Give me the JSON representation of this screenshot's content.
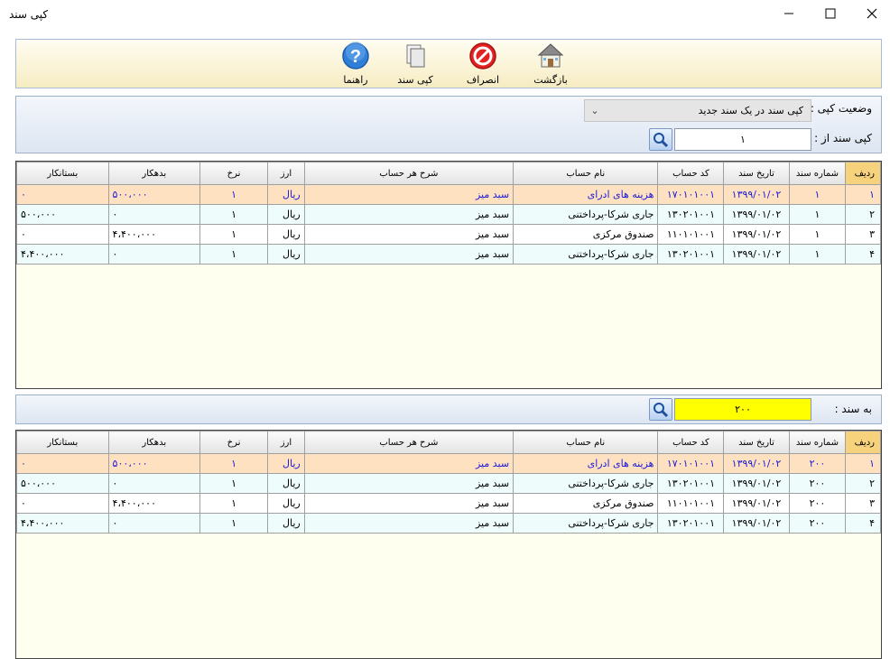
{
  "window": {
    "title": "کپی سند"
  },
  "toolbar": {
    "back_label": "بازگشت",
    "cancel_label": "انصراف",
    "copy_label": "کپی سند",
    "help_label": "راهنما"
  },
  "copy_panel": {
    "status_label": "وضعیت کپی :",
    "status_value": "کپی سند در یک سند جدید",
    "from_label": "کپی سند از :",
    "from_value": "۱"
  },
  "target_panel": {
    "to_label": "به سند :",
    "to_value": "۲۰۰"
  },
  "columns": [
    "ردیف",
    "شماره سند",
    "تاریخ سند",
    "کد حساب",
    "نام حساب",
    "شرح هر حساب",
    "ارز",
    "نرخ",
    "بدهکار",
    "بستانکار"
  ],
  "source_rows": [
    [
      "۱",
      "۱",
      "۱۳۹۹/۰۱/۰۲",
      "۱۷۰۱۰۱۰۰۱",
      "هزینه های ادرای",
      "سبد میز",
      "ریال",
      "۱",
      "۵۰۰،۰۰۰",
      "۰"
    ],
    [
      "۲",
      "۱",
      "۱۳۹۹/۰۱/۰۲",
      "۱۳۰۲۰۱۰۰۱",
      "جاری شرکا-پرداختنی",
      "سبد میز",
      "ریال",
      "۱",
      "۰",
      "۵۰۰،۰۰۰"
    ],
    [
      "۳",
      "۱",
      "۱۳۹۹/۰۱/۰۲",
      "۱۱۰۱۰۱۰۰۱",
      "صندوق مرکزی",
      "سبد میز",
      "ریال",
      "۱",
      "۴،۴۰۰،۰۰۰",
      "۰"
    ],
    [
      "۴",
      "۱",
      "۱۳۹۹/۰۱/۰۲",
      "۱۳۰۲۰۱۰۰۱",
      "جاری شرکا-پرداختنی",
      "سبد میز",
      "ریال",
      "۱",
      "۰",
      "۴،۴۰۰،۰۰۰"
    ]
  ],
  "target_rows": [
    [
      "۱",
      "۲۰۰",
      "۱۳۹۹/۰۱/۰۲",
      "۱۷۰۱۰۱۰۰۱",
      "هزینه های ادرای",
      "سبد میز",
      "ریال",
      "۱",
      "۵۰۰،۰۰۰",
      "۰"
    ],
    [
      "۲",
      "۲۰۰",
      "۱۳۹۹/۰۱/۰۲",
      "۱۳۰۲۰۱۰۰۱",
      "جاری شرکا-پرداختنی",
      "سبد میز",
      "ریال",
      "۱",
      "۰",
      "۵۰۰،۰۰۰"
    ],
    [
      "۳",
      "۲۰۰",
      "۱۳۹۹/۰۱/۰۲",
      "۱۱۰۱۰۱۰۰۱",
      "صندوق مرکزی",
      "سبد میز",
      "ریال",
      "۱",
      "۴،۴۰۰،۰۰۰",
      "۰"
    ],
    [
      "۴",
      "۲۰۰",
      "۱۳۹۹/۰۱/۰۲",
      "۱۳۰۲۰۱۰۰۱",
      "جاری شرکا-پرداختنی",
      "سبد میز",
      "ریال",
      "۱",
      "۰",
      "۴،۴۰۰،۰۰۰"
    ]
  ]
}
